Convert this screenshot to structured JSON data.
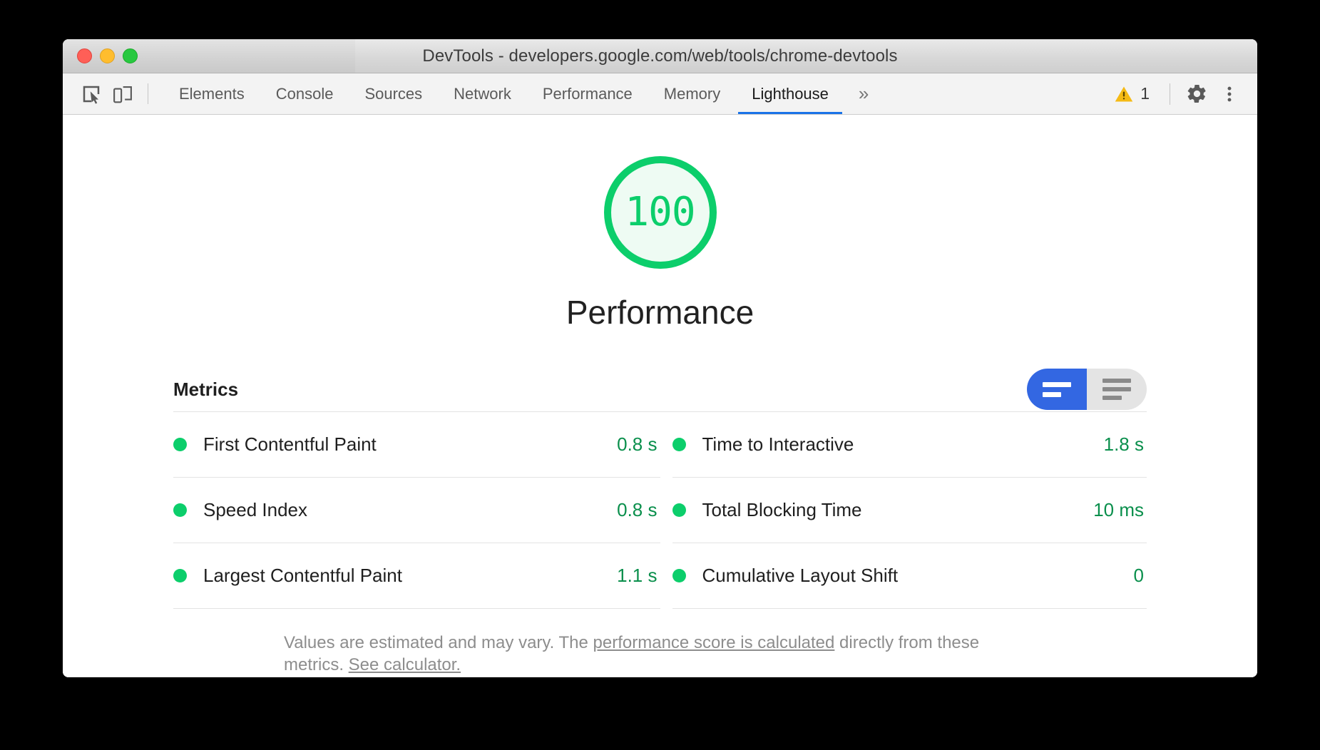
{
  "window": {
    "title": "DevTools - developers.google.com/web/tools/chrome-devtools",
    "traffic_lights": [
      {
        "name": "close",
        "color": "#ff5f57"
      },
      {
        "name": "minimize",
        "color": "#ffbd2e"
      },
      {
        "name": "maximize",
        "color": "#28c840"
      }
    ]
  },
  "toolbar": {
    "inspect_icon": "inspect-element-icon",
    "device_icon": "device-toolbar-icon",
    "tabs": [
      {
        "label": "Elements",
        "selected": false
      },
      {
        "label": "Console",
        "selected": false
      },
      {
        "label": "Sources",
        "selected": false
      },
      {
        "label": "Network",
        "selected": false
      },
      {
        "label": "Performance",
        "selected": false
      },
      {
        "label": "Memory",
        "selected": false
      },
      {
        "label": "Lighthouse",
        "selected": true
      }
    ],
    "more_tabs_label": "»",
    "warning": {
      "icon": "warning-triangle-icon",
      "count": "1",
      "color": "#f5ba15"
    },
    "settings_icon": "gear-icon",
    "more_options_icon": "three-dots-vertical-icon",
    "accent_color": "#1a73e8"
  },
  "report": {
    "gauge": {
      "score": "100",
      "category": "Performance",
      "stroke_color": "#0cce6b",
      "fill_color": "#eefbf3"
    },
    "metrics": {
      "section_title": "Metrics",
      "toggle": {
        "active_view": "simple",
        "simple_label": "simple-view-toggle",
        "expanded_label": "expanded-view-toggle",
        "active_color": "#3367e2",
        "inactive_color": "#e4e4e4"
      },
      "left_column": [
        {
          "name": "First Contentful Paint",
          "value": "0.8 s",
          "status": "pass"
        },
        {
          "name": "Speed Index",
          "value": "0.8 s",
          "status": "pass"
        },
        {
          "name": "Largest Contentful Paint",
          "value": "1.1 s",
          "status": "pass"
        }
      ],
      "right_column": [
        {
          "name": "Time to Interactive",
          "value": "1.8 s",
          "status": "pass"
        },
        {
          "name": "Total Blocking Time",
          "value": "10 ms",
          "status": "pass"
        },
        {
          "name": "Cumulative Layout Shift",
          "value": "0",
          "status": "pass"
        }
      ],
      "pass_color": "#0cce6b",
      "value_color": "#0a8f4c"
    },
    "footnote": {
      "text_1": "Values are estimated and may vary. The ",
      "link_1": "performance score is calculated",
      "text_2": " directly from these metrics. ",
      "link_2": "See calculator."
    }
  }
}
